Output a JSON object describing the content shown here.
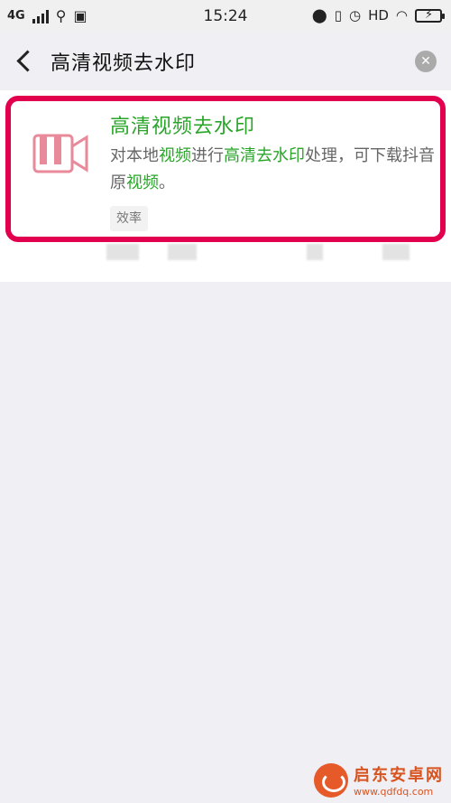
{
  "status_bar": {
    "network": "4G",
    "time": "15:24",
    "hd": "HD"
  },
  "search": {
    "query": "高清视频去水印"
  },
  "result": {
    "title": "高清视频去水印",
    "desc_parts": [
      {
        "text": "对本地",
        "hl": false
      },
      {
        "text": "视频",
        "hl": true
      },
      {
        "text": "进行",
        "hl": false
      },
      {
        "text": "高清去水印",
        "hl": true
      },
      {
        "text": "处理，可下载抖音原",
        "hl": false
      },
      {
        "text": "视频",
        "hl": true
      },
      {
        "text": "。",
        "hl": false
      }
    ],
    "tag": "效率"
  },
  "colors": {
    "highlight": "#2aa52a",
    "card_border": "#e2004e",
    "icon": "#e88a9a"
  },
  "watermark": {
    "title": "启东安卓网",
    "url": "www.qdfdq.com"
  }
}
